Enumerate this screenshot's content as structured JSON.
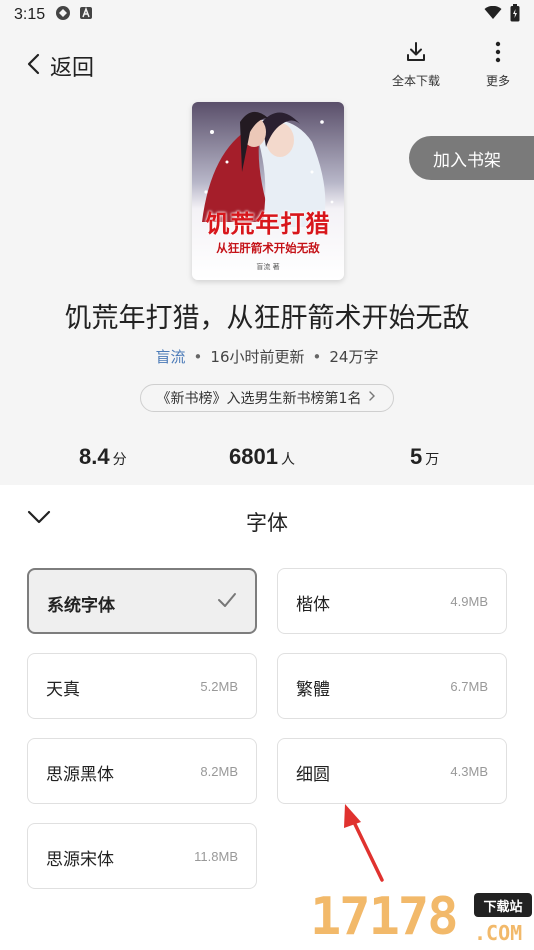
{
  "status_bar": {
    "time": "3:15"
  },
  "nav": {
    "back_label": "返回",
    "download_label": "全本下载",
    "more_label": "更多"
  },
  "book": {
    "cover_title": "饥荒年打猎",
    "cover_subtitle": "从狂肝箭术开始无敌",
    "cover_author": "盲流 著",
    "add_to_shelf": "加入书架",
    "title": "饥荒年打猎，从狂肝箭术开始无敌",
    "author": "盲流",
    "updated": "16小时前更新",
    "word_count": "24万字",
    "rank_text": "《新书榜》入选男生新书榜第1名",
    "stats": [
      {
        "value": "8.4",
        "unit": "分"
      },
      {
        "value": "6801",
        "unit": "人"
      },
      {
        "value": "5",
        "unit": "万"
      }
    ]
  },
  "font_panel": {
    "title": "字体",
    "fonts": [
      {
        "name": "系统字体",
        "size": "",
        "selected": true
      },
      {
        "name": "楷体",
        "size": "4.9MB",
        "selected": false
      },
      {
        "name": "天真",
        "size": "5.2MB",
        "selected": false
      },
      {
        "name": "繁體",
        "size": "6.7MB",
        "selected": false
      },
      {
        "name": "思源黑体",
        "size": "8.2MB",
        "selected": false
      },
      {
        "name": "细圆",
        "size": "4.3MB",
        "selected": false
      },
      {
        "name": "思源宋体",
        "size": "11.8MB",
        "selected": false
      }
    ]
  },
  "watermark": {
    "number": "17178",
    "badge": "下载站",
    "domain": ".COM"
  },
  "colors": {
    "accent_link": "#4c7bb8",
    "shelf_button": "#7a7a7a",
    "annotation_arrow": "#e0322f",
    "watermark": "#f2b96a"
  }
}
